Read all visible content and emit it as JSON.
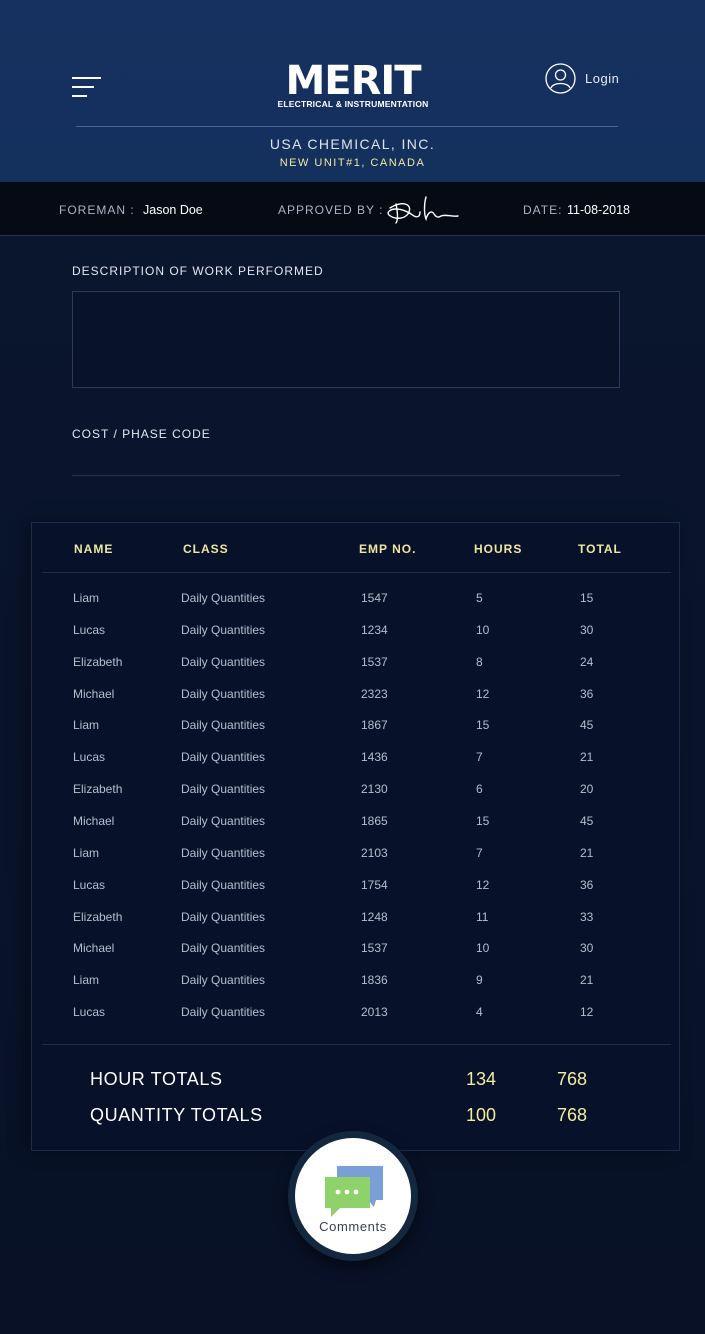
{
  "header": {
    "logo_text": "MERIT",
    "logo_subtitle": "ELECTRICAL & INSTRUMENTATION",
    "login_label": "Login",
    "company_name": "USA CHEMICAL, INC.",
    "company_location": "NEW UNIT#1, CANADA"
  },
  "info_bar": {
    "foreman_label": "FOREMAN :",
    "foreman_value": "Jason Doe",
    "approved_label": "APPROVED BY :",
    "date_label": "DATE:",
    "date_value": "11-08-2018"
  },
  "form": {
    "description_label": "DESCRIPTION OF WORK PERFORMED",
    "description_value": "",
    "cost_label": "COST / PHASE CODE",
    "cost_value": ""
  },
  "table": {
    "columns": [
      "NAME",
      "CLASS",
      "EMP NO.",
      "HOURS",
      "TOTAL"
    ],
    "rows": [
      [
        "Liam",
        "Daily Quantities",
        "1547",
        "5",
        "15"
      ],
      [
        "Lucas",
        "Daily Quantities",
        "1234",
        "10",
        "30"
      ],
      [
        "Elizabeth",
        "Daily Quantities",
        "1537",
        "8",
        "24"
      ],
      [
        "Michael",
        "Daily Quantities",
        "2323",
        "12",
        "36"
      ],
      [
        "Liam",
        "Daily Quantities",
        "1867",
        "15",
        "45"
      ],
      [
        "Lucas",
        "Daily Quantities",
        "1436",
        "7",
        "21"
      ],
      [
        "Elizabeth",
        "Daily Quantities",
        "2130",
        "6",
        "20"
      ],
      [
        "Michael",
        "Daily Quantities",
        "1865",
        "15",
        "45"
      ],
      [
        "Liam",
        "Daily Quantities",
        "2103",
        "7",
        "21"
      ],
      [
        "Lucas",
        "Daily Quantities",
        "1754",
        "12",
        "36"
      ],
      [
        "Elizabeth",
        "Daily Quantities",
        "1248",
        "11",
        "33"
      ],
      [
        "Michael",
        "Daily Quantities",
        "1537",
        "10",
        "30"
      ],
      [
        "Liam",
        "Daily Quantities",
        "1836",
        "9",
        "21"
      ],
      [
        "Lucas",
        "Daily Quantities",
        "2013",
        "4",
        "12"
      ]
    ],
    "hour_totals_label": "HOUR TOTALS",
    "hour_totals_hours": "134",
    "hour_totals_total": "768",
    "quantity_totals_label": "QUANTITY TOTALS",
    "quantity_totals_hours": "100",
    "quantity_totals_total": "768"
  },
  "comments": {
    "label": "Comments",
    "icon": "chat-bubbles-icon"
  },
  "colors": {
    "header_bg": "#16315f",
    "page_bg": "#09142b",
    "accent_yellow": "#f3eda0",
    "comment_green": "#8fd16a",
    "comment_blue": "#7a9fd6"
  }
}
